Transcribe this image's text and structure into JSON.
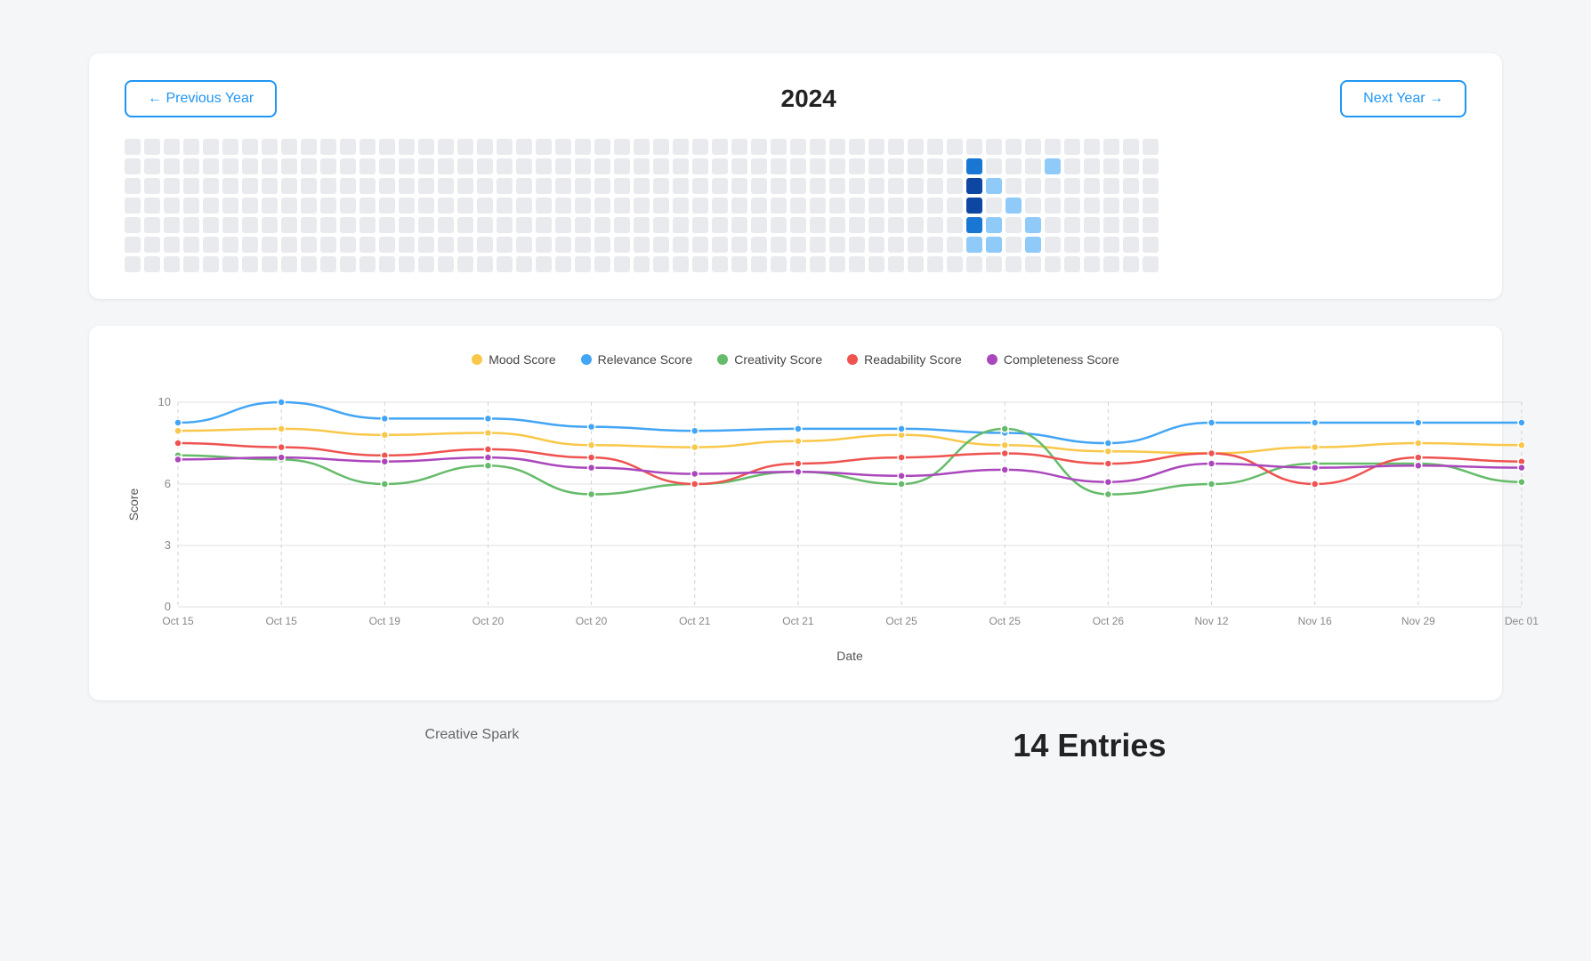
{
  "header": {
    "year": "2024",
    "prev_btn": "← Previous Year",
    "next_btn": "Next Year →"
  },
  "legend": [
    {
      "id": "mood",
      "label": "Mood Score",
      "color": "#f9c84a"
    },
    {
      "id": "relevance",
      "label": "Relevance Score",
      "color": "#42a5f5"
    },
    {
      "id": "creativity",
      "label": "Creativity Score",
      "color": "#66bb6a"
    },
    {
      "id": "readability",
      "label": "Readability Score",
      "color": "#ef5350"
    },
    {
      "id": "completeness",
      "label": "Completeness Score",
      "color": "#ab47bc"
    }
  ],
  "chart": {
    "y_axis_label": "Score",
    "x_axis_label": "Date",
    "y_ticks": [
      0,
      3,
      6,
      10
    ],
    "x_labels": [
      "Oct 15",
      "Oct 15",
      "Oct 19",
      "Oct 20",
      "Oct 20",
      "Oct 21",
      "Oct 21",
      "Oct 25",
      "Oct 25",
      "Oct 26",
      "Nov 12",
      "Nov 16",
      "Nov 29",
      "Dec 01"
    ],
    "series": {
      "mood": [
        8.6,
        8.7,
        8.4,
        8.5,
        7.9,
        7.8,
        8.1,
        8.4,
        7.9,
        7.6,
        7.5,
        7.8,
        8.0,
        7.9
      ],
      "relevance": [
        9.0,
        10.0,
        9.2,
        9.2,
        8.8,
        8.6,
        8.7,
        8.7,
        8.5,
        8.0,
        9.0,
        9.0,
        9.0,
        9.0
      ],
      "creativity": [
        7.4,
        7.2,
        6.0,
        6.9,
        5.5,
        6.0,
        6.6,
        6.0,
        8.7,
        5.5,
        6.0,
        7.0,
        7.0,
        6.1
      ],
      "readability": [
        8.0,
        7.8,
        7.4,
        7.7,
        7.3,
        6.0,
        7.0,
        7.3,
        7.5,
        7.0,
        7.5,
        6.0,
        7.3,
        7.1
      ],
      "completeness": [
        7.2,
        7.3,
        7.1,
        7.3,
        6.8,
        6.5,
        6.6,
        6.4,
        6.7,
        6.1,
        7.0,
        6.8,
        6.9,
        6.8
      ]
    }
  },
  "stats": [
    {
      "label": "Creative Spark",
      "value": ""
    },
    {
      "label": "14 Entries",
      "value": ""
    }
  ]
}
